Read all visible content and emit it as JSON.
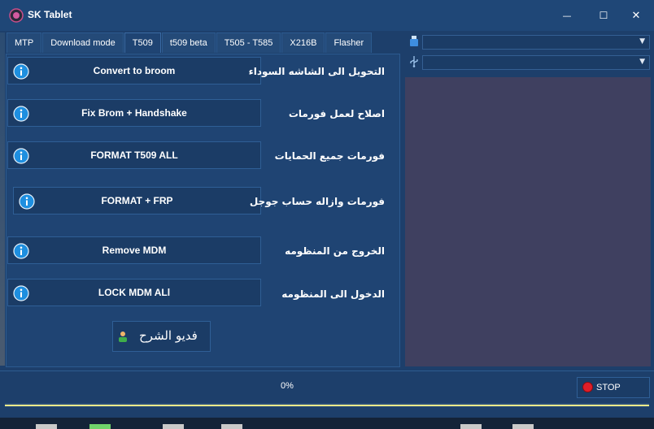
{
  "window": {
    "title": "SK Tablet",
    "minimize_label": "—",
    "maximize_label": "☐",
    "close_label": "✕"
  },
  "tabs": [
    {
      "label": "MTP",
      "active": false
    },
    {
      "label": "Download mode",
      "active": false
    },
    {
      "label": "T509",
      "active": true
    },
    {
      "label": "t509 beta",
      "active": false
    },
    {
      "label": "T505 - T585",
      "active": false
    },
    {
      "label": "X216B",
      "active": false
    },
    {
      "label": "Flasher",
      "active": false
    }
  ],
  "actions": [
    {
      "button": "Convert to broom",
      "arabic": "التحويل الى الشاشه السوداء"
    },
    {
      "button": "Fix Brom + Handshake",
      "arabic": "اصلاح لعمل فورمات"
    },
    {
      "button": "FORMAT T509 ALL",
      "arabic": "فورمات جميع الحمايات"
    },
    {
      "button": "FORMAT + FRP",
      "arabic": "فورمات وازاله حساب جوجل"
    },
    {
      "button": "Remove MDM",
      "arabic": "الخروج من المنظومه"
    },
    {
      "button": "LOCK MDM ALl",
      "arabic": "الدخول الى المنظومه"
    }
  ],
  "video_button": {
    "label": "فديو الشرح"
  },
  "ports": {
    "port1_value": "",
    "port2_value": ""
  },
  "status": {
    "progress_text": "0%",
    "progress": 0.0
  },
  "stop_button": {
    "label": "STOP"
  },
  "colors": {
    "background": "#1d3f6b",
    "log_background": "#3f4060",
    "info_icon": "#1e8fe0",
    "stop": "#e01e28",
    "progress_rail": "#ecea8a"
  }
}
